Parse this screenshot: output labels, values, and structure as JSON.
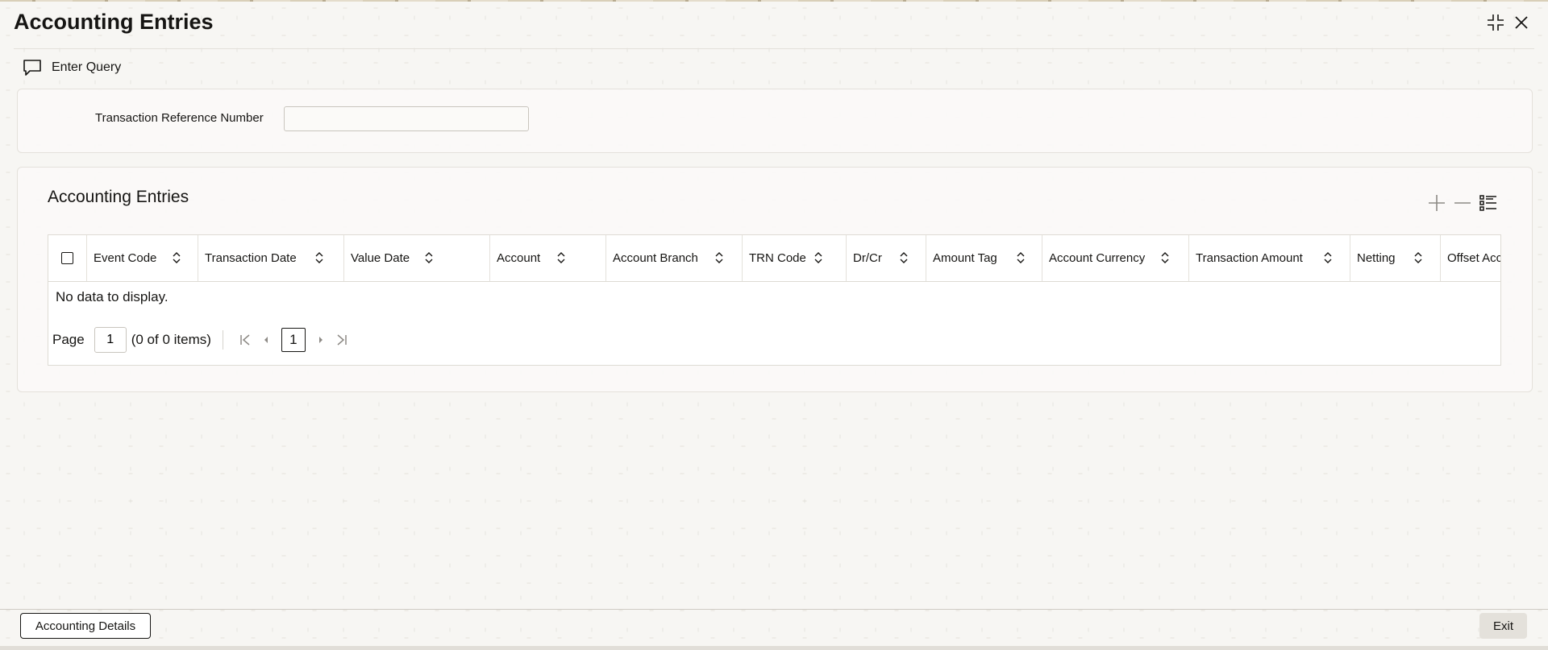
{
  "window": {
    "title": "Accounting Entries"
  },
  "toolbar": {
    "enter_query_label": "Enter Query"
  },
  "query": {
    "transaction_reference_label": "Transaction Reference Number",
    "transaction_reference_value": ""
  },
  "entries": {
    "section_title": "Accounting Entries",
    "columns": [
      "Event Code",
      "Transaction Date",
      "Value Date",
      "Account",
      "Account Branch",
      "TRN Code",
      "Dr/Cr",
      "Amount Tag",
      "Account Currency",
      "Transaction Amount",
      "Netting",
      "Offset Account"
    ],
    "empty_message": "No data to display.",
    "pagination": {
      "page_label": "Page",
      "page_value": "1",
      "count_text": "(0 of 0 items)",
      "current_page": "1"
    }
  },
  "footer": {
    "accounting_details_label": "Accounting Details",
    "exit_label": "Exit"
  },
  "icons": {
    "enter_query": "chat-bubble-icon",
    "maximize": "collapse-corners-icon",
    "close": "close-icon",
    "add_row": "plus-icon",
    "delete_row": "minus-icon",
    "single_record_view": "list-view-icon",
    "sort": "sort-updown-icon",
    "first_page": "first-page-icon",
    "prev_page": "prev-page-icon",
    "next_page": "next-page-icon",
    "last_page": "last-page-icon"
  }
}
